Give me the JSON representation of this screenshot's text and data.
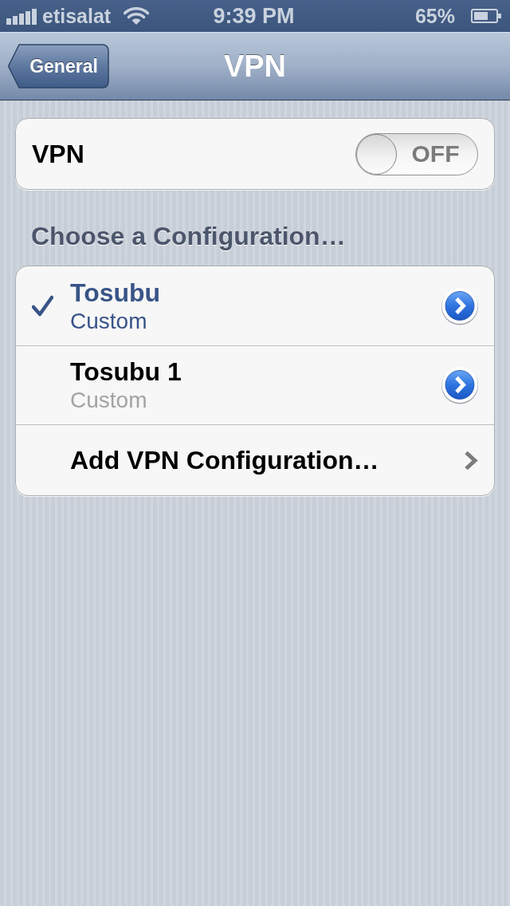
{
  "status_bar": {
    "carrier": "etisalat",
    "time": "9:39 PM",
    "battery": "65%"
  },
  "nav_bar": {
    "back_button": "General",
    "title": "VPN"
  },
  "vpn_toggle": {
    "label": "VPN",
    "on": false,
    "state_text": "OFF"
  },
  "section_header": "Choose a Configuration…",
  "configurations": [
    {
      "name": "Tosubu",
      "type": "Custom",
      "selected": true
    },
    {
      "name": "Tosubu 1",
      "type": "Custom",
      "selected": false
    }
  ],
  "add_row": {
    "label": "Add VPN Configuration…"
  }
}
